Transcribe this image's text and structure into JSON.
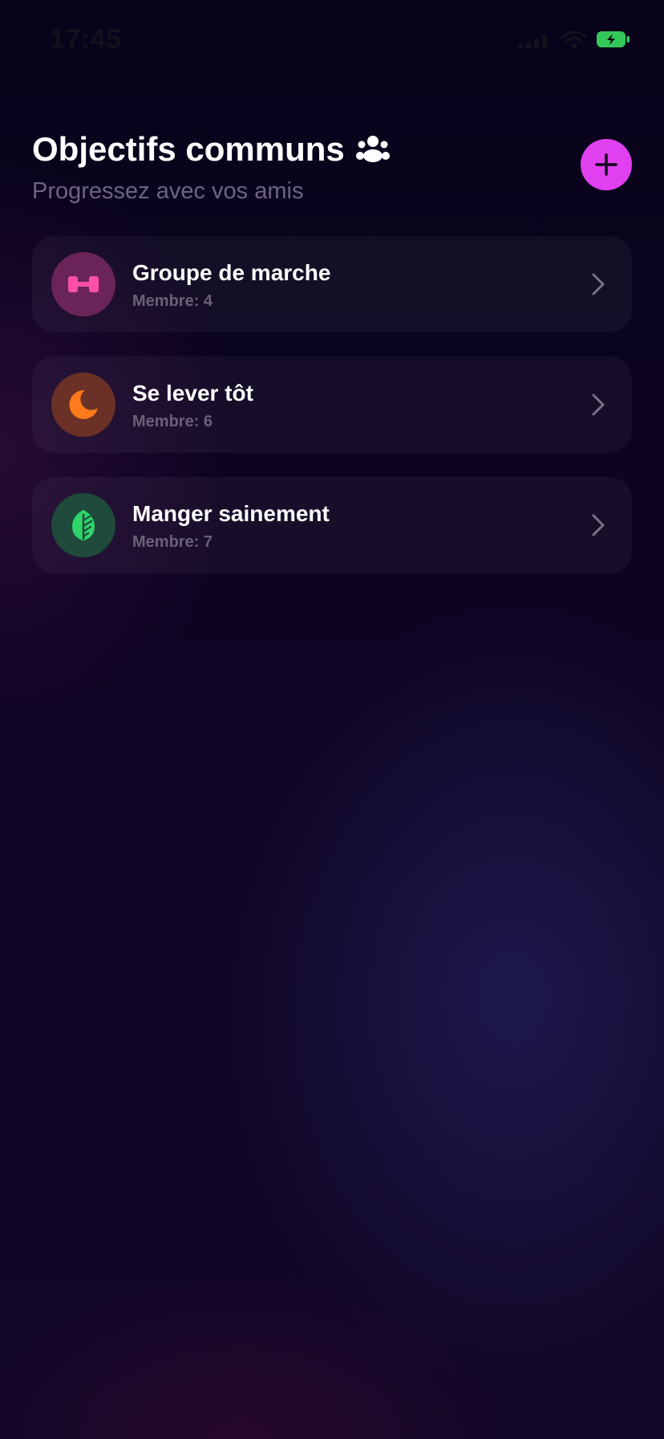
{
  "status_bar": {
    "time": "17:45"
  },
  "header": {
    "title": "Objectifs communs",
    "title_icon": "group-icon",
    "subtitle": "Progressez avec vos amis"
  },
  "add_button": {
    "icon": "plus-icon",
    "color": "#e040f0"
  },
  "goals": [
    {
      "name": "Groupe de marche",
      "members": "Membre: 4",
      "icon": "dumbbell-icon",
      "icon_color": "#ff4fa8",
      "avatar_bg": "#6a2458"
    },
    {
      "name": "Se lever tôt",
      "members": "Membre: 6",
      "icon": "moon-icon",
      "icon_color": "#ff7a1a",
      "avatar_bg": "#6b3026"
    },
    {
      "name": "Manger sainement",
      "members": "Membre: 7",
      "icon": "leaf-icon",
      "icon_color": "#2ed46a",
      "avatar_bg": "#1f4a3c"
    }
  ],
  "colors": {
    "background": "#0e0422",
    "subtitle": "#6e6481",
    "card": "#1a1326",
    "battery": "#34c759"
  }
}
